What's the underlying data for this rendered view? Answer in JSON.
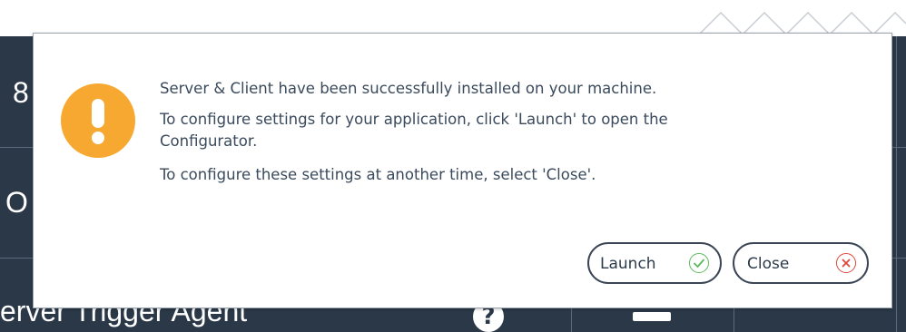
{
  "background": {
    "row_texts": [
      "8",
      "O"
    ],
    "bottom_text": "erver Trigger Agent",
    "help_icon": "question-circle-icon",
    "keyboard_icon": "keyboard-icon"
  },
  "dialog": {
    "icon": "warning-exclamation-icon",
    "icon_color": "#f6a830",
    "messages": [
      "Server & Client have been successfully installed on your machine.",
      "To configure settings for your application, click 'Launch' to open the",
      "Configurator.",
      "To configure these settings at another time, select 'Close'."
    ],
    "buttons": {
      "launch": {
        "label": "Launch",
        "icon": "check-circle-icon",
        "icon_color": "#5cb85c"
      },
      "close": {
        "label": "Close",
        "icon": "x-circle-icon",
        "icon_color": "#e0463a"
      }
    }
  }
}
